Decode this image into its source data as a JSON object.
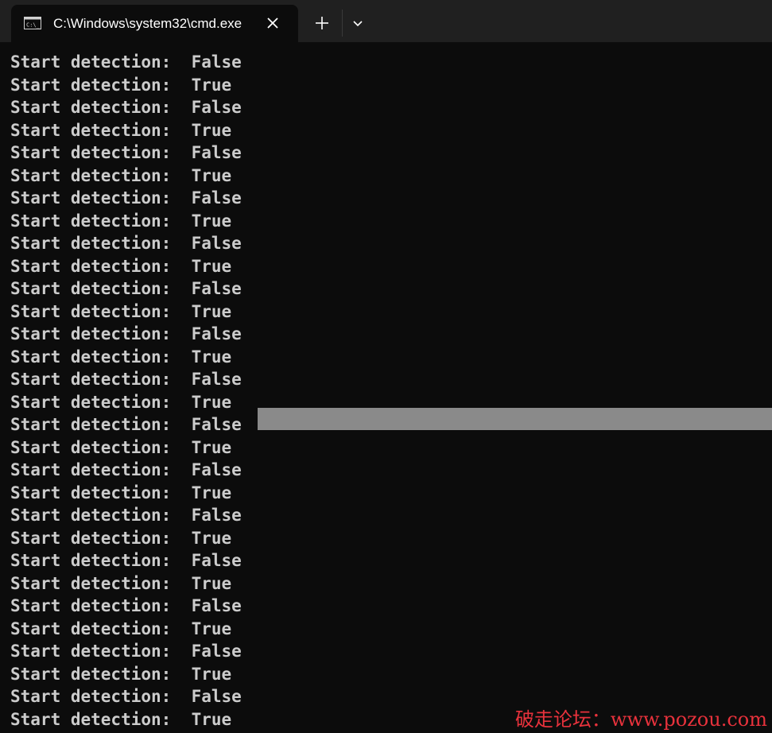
{
  "tab": {
    "title": "C:\\Windows\\system32\\cmd.exe",
    "icon": "cmd-icon"
  },
  "controls": {
    "close_icon": "close-icon",
    "new_tab_icon": "plus-icon",
    "dropdown_icon": "chevron-down-icon"
  },
  "colors": {
    "terminal_bg": "#0c0c0c",
    "terminal_text": "#cccccc",
    "tabbar_bg": "#202020",
    "cursor": "#8a8a8a",
    "watermark": "#e8323c"
  },
  "terminal": {
    "lines": [
      "Start detection:  False",
      "Start detection:  True",
      "Start detection:  False",
      "Start detection:  True",
      "Start detection:  False",
      "Start detection:  True",
      "Start detection:  False",
      "Start detection:  True",
      "Start detection:  False",
      "Start detection:  True",
      "Start detection:  False",
      "Start detection:  True",
      "Start detection:  False",
      "Start detection:  True",
      "Start detection:  False",
      "Start detection:  True",
      "Start detection:  False",
      "Start detection:  True",
      "Start detection:  False",
      "Start detection:  True",
      "Start detection:  False",
      "Start detection:  True",
      "Start detection:  False",
      "Start detection:  True",
      "Start detection:  False",
      "Start detection:  True",
      "Start detection:  False",
      "Start detection:  True",
      "Start detection:  False",
      "Start detection:  True"
    ]
  },
  "watermark": "破走论坛：www.pozou.com"
}
